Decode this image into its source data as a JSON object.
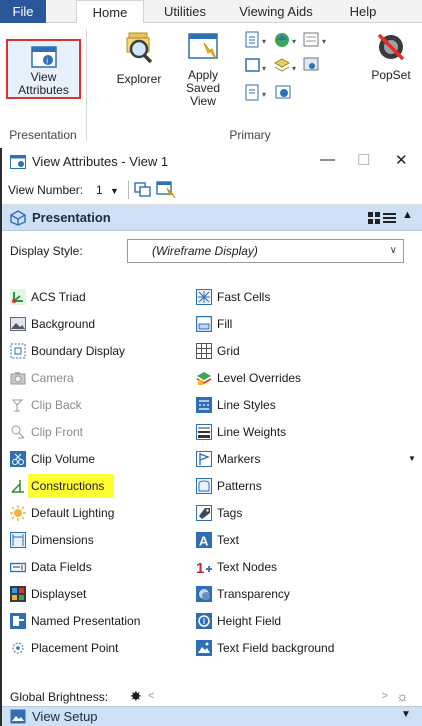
{
  "ribbon": {
    "tabs": [
      {
        "label": "File"
      },
      {
        "label": "Home"
      },
      {
        "label": "Utilities"
      },
      {
        "label": "Viewing Aids"
      },
      {
        "label": "Help"
      }
    ],
    "buttons": {
      "view_attributes": "View\nAttributes",
      "explorer": "Explorer",
      "apply_saved_view": "Apply\nSaved View",
      "popset": "PopSet"
    },
    "groups": {
      "presentation": "Presentation",
      "primary": "Primary"
    }
  },
  "window": {
    "title": "View Attributes - View 1",
    "minimize": "—",
    "maximize": "☐",
    "close": "✕",
    "view_number_label": "View Number:",
    "view_number_value": "1"
  },
  "presentation": {
    "header": "Presentation",
    "display_style_label": "Display Style:",
    "display_style_value": "(Wireframe Display)",
    "left_items": [
      {
        "label": "ACS Triad",
        "icon": "acs-triad-icon",
        "enabled": true
      },
      {
        "label": "Background",
        "icon": "background-icon",
        "enabled": true
      },
      {
        "label": "Boundary Display",
        "icon": "boundary-display-icon",
        "enabled": true
      },
      {
        "label": "Camera",
        "icon": "camera-icon",
        "enabled": false
      },
      {
        "label": "Clip Back",
        "icon": "clip-back-icon",
        "enabled": false
      },
      {
        "label": "Clip Front",
        "icon": "clip-front-icon",
        "enabled": false
      },
      {
        "label": "Clip Volume",
        "icon": "clip-volume-icon",
        "enabled": true
      },
      {
        "label": "Constructions",
        "icon": "constructions-icon",
        "enabled": true,
        "highlighted": true
      },
      {
        "label": "Default Lighting",
        "icon": "default-lighting-icon",
        "enabled": true
      },
      {
        "label": "Dimensions",
        "icon": "dimensions-icon",
        "enabled": true
      },
      {
        "label": "Data Fields",
        "icon": "data-fields-icon",
        "enabled": true
      },
      {
        "label": "Displayset",
        "icon": "displayset-icon",
        "enabled": true
      },
      {
        "label": "Named Presentation",
        "icon": "named-presentation-icon",
        "enabled": true
      },
      {
        "label": "Placement Point",
        "icon": "placement-point-icon",
        "enabled": true
      }
    ],
    "right_items": [
      {
        "label": "Fast Cells",
        "icon": "fast-cells-icon"
      },
      {
        "label": "Fill",
        "icon": "fill-icon"
      },
      {
        "label": "Grid",
        "icon": "grid-icon"
      },
      {
        "label": "Level Overrides",
        "icon": "level-overrides-icon"
      },
      {
        "label": "Line Styles",
        "icon": "line-styles-icon"
      },
      {
        "label": "Line Weights",
        "icon": "line-weights-icon"
      },
      {
        "label": "Markers",
        "icon": "markers-icon"
      },
      {
        "label": "Patterns",
        "icon": "patterns-icon"
      },
      {
        "label": "Tags",
        "icon": "tags-icon"
      },
      {
        "label": "Text",
        "icon": "text-icon"
      },
      {
        "label": "Text Nodes",
        "icon": "text-nodes-icon"
      },
      {
        "label": "Transparency",
        "icon": "transparency-icon"
      },
      {
        "label": "Height Field",
        "icon": "height-field-icon"
      },
      {
        "label": "Text Field background",
        "icon": "text-field-background-icon"
      }
    ],
    "global_brightness_label": "Global Brightness:"
  },
  "view_setup": {
    "header": "View Setup"
  },
  "colors": {
    "accent_blue": "#2b579a",
    "panel_header": "#cfe0f4",
    "highlight": "#ffff33",
    "red_outline": "#e0302b"
  }
}
